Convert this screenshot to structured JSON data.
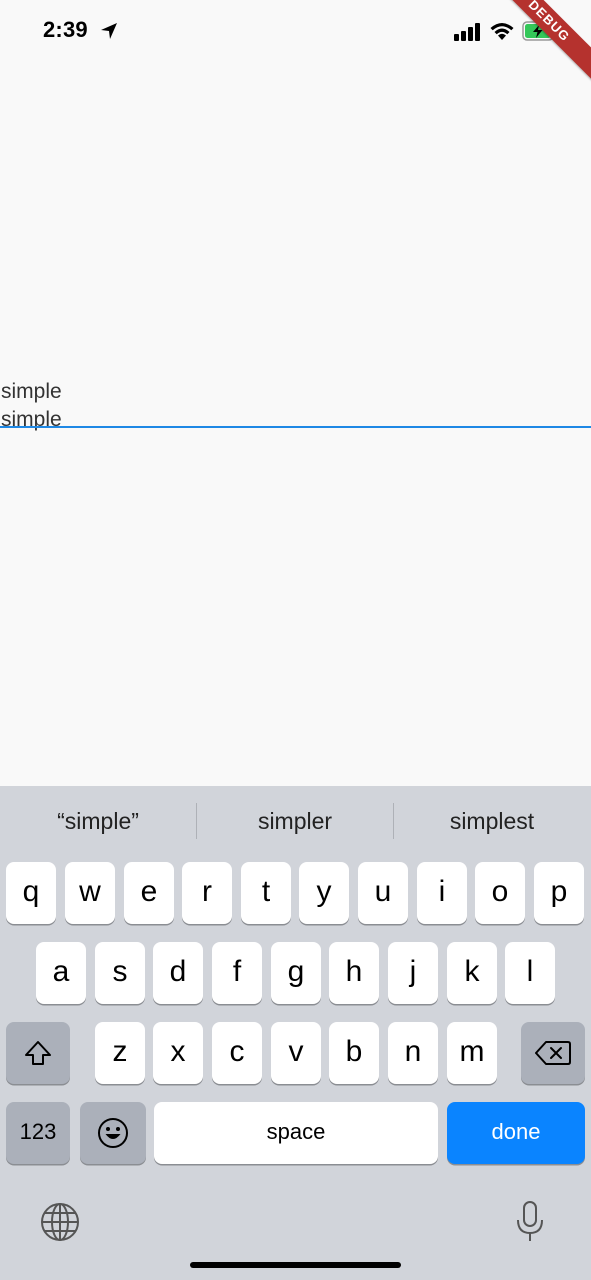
{
  "status_bar": {
    "time": "2:39",
    "icons": [
      "location-arrow-icon",
      "cellular-signal-icon",
      "wifi-icon",
      "battery-charging-icon"
    ],
    "battery_color": "#34c759"
  },
  "debug_banner": {
    "label": "DEBUG",
    "color": "#b5322e"
  },
  "content": {
    "text_line_1": "simple",
    "text_line_2": "simple",
    "underline_color": "#1e88e5"
  },
  "keyboard": {
    "suggestions": [
      "“simple”",
      "simpler",
      "simplest"
    ],
    "row1": [
      "q",
      "w",
      "e",
      "r",
      "t",
      "y",
      "u",
      "i",
      "o",
      "p"
    ],
    "row2": [
      "a",
      "s",
      "d",
      "f",
      "g",
      "h",
      "j",
      "k",
      "l"
    ],
    "row3": [
      "z",
      "x",
      "c",
      "v",
      "b",
      "n",
      "m"
    ],
    "numbers_label": "123",
    "space_label": "space",
    "done_label": "done",
    "done_color": "#0a84ff"
  }
}
